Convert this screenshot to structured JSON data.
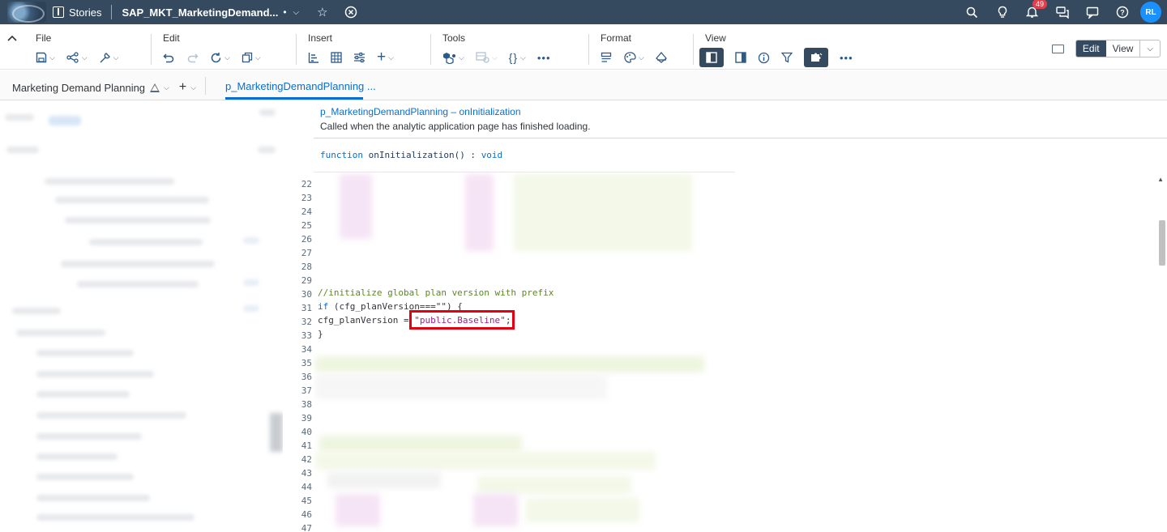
{
  "shell": {
    "app_name": "Stories",
    "story_title": "SAP_MKT_MarketingDemand...",
    "dirty_marker": "•",
    "notification_count": "49",
    "avatar_initials": "RL"
  },
  "toolbar": {
    "groups": {
      "file": "File",
      "edit": "Edit",
      "insert": "Insert",
      "tools": "Tools",
      "format": "Format",
      "view": "View"
    },
    "modes": {
      "edit": "Edit",
      "view": "View"
    }
  },
  "tabs": {
    "story_name": "Marketing Demand Planning",
    "active_tab": "p_MarketingDemandPlanning ..."
  },
  "script": {
    "title": "p_MarketingDemandPlanning – onInitialization",
    "description": "Called when the analytic application page has finished loading.",
    "signature_keyword": "function",
    "signature_name": " onInitialization() : ",
    "signature_return": "void",
    "line_numbers": [
      "22",
      "23",
      "24",
      "25",
      "26",
      "27",
      "28",
      "29",
      "30",
      "31",
      "32",
      "33",
      "34",
      "35",
      "36",
      "37",
      "38",
      "39",
      "40",
      "41",
      "42",
      "43",
      "44",
      "45",
      "46",
      "47"
    ],
    "line30_comment": "//initialize global plan version with prefix",
    "line31_kw": "if",
    "line31_rest": " (cfg_planVersion===\"\") {",
    "line32_lhs": "cfg_planVersion = ",
    "line32_str": "\"public.Baseline\"",
    "line32_end": ";",
    "line33": "}"
  },
  "colors": {
    "shell_bg": "#354a5f",
    "accent": "#0a6ed1",
    "highlight_box": "#e3000f",
    "string": "#a31c8c",
    "comment": "#5a8a1e"
  }
}
